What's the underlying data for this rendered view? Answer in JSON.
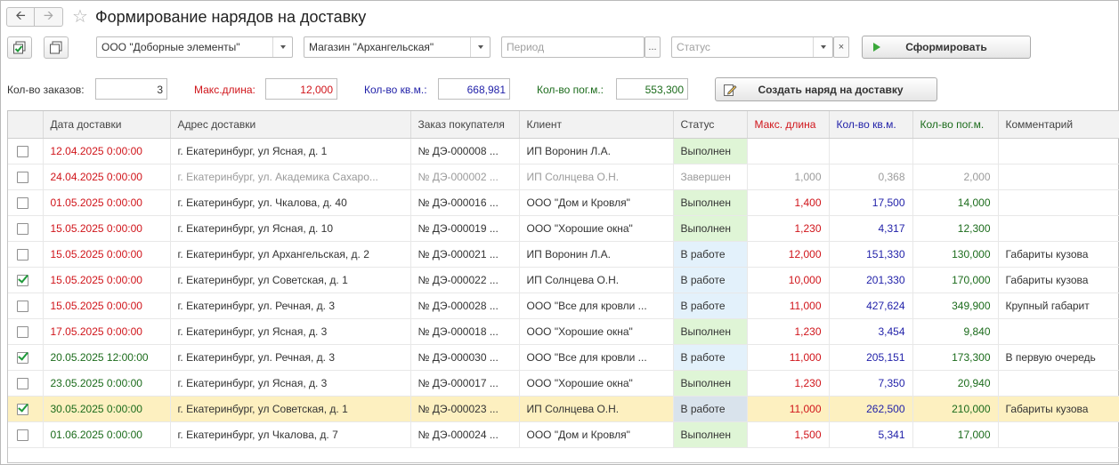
{
  "window": {
    "title": "Формирование нарядов на доставку"
  },
  "toolbar": {
    "organization": "ООО \"Доборные элементы\"",
    "store": "Магазин \"Архангельская\"",
    "period_placeholder": "Период",
    "status_placeholder": "Статус",
    "form_button": "Сформировать"
  },
  "summary": {
    "orders_label": "Кол-во заказов:",
    "orders_value": "3",
    "maxlen_label": "Макс.длина:",
    "maxlen_value": "12,000",
    "sqm_label": "Кол-во кв.м.:",
    "sqm_value": "668,981",
    "lm_label": "Кол-во пог.м.:",
    "lm_value": "553,300",
    "create_button": "Создать наряд на доставку"
  },
  "colors": {
    "red": "#d0141a",
    "blue": "#1f1fa8",
    "green": "#1b6b1b",
    "gray": "#9b9b9b",
    "status_done": "#dff5d6",
    "status_work": "#e3f1fb",
    "status_sel": "#d9e3ec",
    "selected_row": "#fdf0c0"
  },
  "table": {
    "columns": [
      "Дата доставки",
      "Адрес доставки",
      "Заказ покупателя",
      "Клиент",
      "Статус",
      "Макс. длина",
      "Кол-во кв.м.",
      "Кол-во пог.м.",
      "Комментарий"
    ],
    "rows": [
      {
        "checked": false,
        "date": "12.04.2025 0:00:00",
        "date_color": "red",
        "address": "г. Екатеринбург, ул Ясная, д. 1",
        "order": "№ ДЭ-000008 ...",
        "client": "ИП Воронин Л.А.",
        "status": "Выполнен",
        "status_type": "done",
        "maxlen": "",
        "sqm": "",
        "lm": "",
        "comment": "",
        "muted": false,
        "selected": false
      },
      {
        "checked": false,
        "date": "24.04.2025 0:00:00",
        "date_color": "red",
        "address": "г. Екатеринбург, ул. Академика Сахаро...",
        "order": "№ ДЭ-000002 ...",
        "client": "ИП Солнцева О.Н.",
        "status": "Завершен",
        "status_type": "closed",
        "maxlen": "1,000",
        "sqm": "0,368",
        "lm": "2,000",
        "comment": "",
        "muted": true,
        "selected": false
      },
      {
        "checked": false,
        "date": "01.05.2025 0:00:00",
        "date_color": "red",
        "address": "г. Екатеринбург, ул. Чкалова, д. 40",
        "order": "№ ДЭ-000016 ...",
        "client": "ООО \"Дом и Кровля\"",
        "status": "Выполнен",
        "status_type": "done",
        "maxlen": "1,400",
        "sqm": "17,500",
        "lm": "14,000",
        "comment": "",
        "muted": false,
        "selected": false
      },
      {
        "checked": false,
        "date": "15.05.2025 0:00:00",
        "date_color": "red",
        "address": "г. Екатеринбург, ул Ясная, д. 10",
        "order": "№ ДЭ-000019 ...",
        "client": "ООО \"Хорошие окна\"",
        "status": "Выполнен",
        "status_type": "done",
        "maxlen": "1,230",
        "sqm": "4,317",
        "lm": "12,300",
        "comment": "",
        "muted": false,
        "selected": false
      },
      {
        "checked": false,
        "date": "15.05.2025 0:00:00",
        "date_color": "red",
        "address": "г. Екатеринбург, ул Архангельская, д. 2",
        "order": "№ ДЭ-000021 ...",
        "client": "ИП Воронин Л.А.",
        "status": "В работе",
        "status_type": "work",
        "maxlen": "12,000",
        "sqm": "151,330",
        "lm": "130,000",
        "comment": "Габариты кузова",
        "muted": false,
        "selected": false
      },
      {
        "checked": true,
        "date": "15.05.2025 0:00:00",
        "date_color": "red",
        "address": "г. Екатеринбург, ул Советская, д. 1",
        "order": "№ ДЭ-000022 ...",
        "client": "ИП Солнцева О.Н.",
        "status": "В работе",
        "status_type": "work",
        "maxlen": "10,000",
        "sqm": "201,330",
        "lm": "170,000",
        "comment": "Габариты кузова",
        "muted": false,
        "selected": false
      },
      {
        "checked": false,
        "date": "15.05.2025 0:00:00",
        "date_color": "red",
        "address": "г. Екатеринбург, ул. Речная, д. 3",
        "order": "№ ДЭ-000028 ...",
        "client": "ООО \"Все для кровли ...",
        "status": "В работе",
        "status_type": "work",
        "maxlen": "11,000",
        "sqm": "427,624",
        "lm": "349,900",
        "comment": "Крупный габарит",
        "muted": false,
        "selected": false
      },
      {
        "checked": false,
        "date": "17.05.2025 0:00:00",
        "date_color": "red",
        "address": "г. Екатеринбург, ул Ясная, д. 3",
        "order": "№ ДЭ-000018 ...",
        "client": "ООО \"Хорошие окна\"",
        "status": "Выполнен",
        "status_type": "done",
        "maxlen": "1,230",
        "sqm": "3,454",
        "lm": "9,840",
        "comment": "",
        "muted": false,
        "selected": false
      },
      {
        "checked": true,
        "date": "20.05.2025 12:00:00",
        "date_color": "green",
        "address": "г. Екатеринбург, ул. Речная, д. 3",
        "order": "№ ДЭ-000030 ...",
        "client": "ООО \"Все для кровли ...",
        "status": "В работе",
        "status_type": "work",
        "maxlen": "11,000",
        "sqm": "205,151",
        "lm": "173,300",
        "comment": "В первую очередь",
        "muted": false,
        "selected": false
      },
      {
        "checked": false,
        "date": "23.05.2025 0:00:00",
        "date_color": "green",
        "address": "г. Екатеринбург, ул Ясная, д. 3",
        "order": "№ ДЭ-000017 ...",
        "client": "ООО \"Хорошие окна\"",
        "status": "Выполнен",
        "status_type": "done",
        "maxlen": "1,230",
        "sqm": "7,350",
        "lm": "20,940",
        "comment": "",
        "muted": false,
        "selected": false
      },
      {
        "checked": true,
        "date": "30.05.2025 0:00:00",
        "date_color": "green",
        "address": "г. Екатеринбург, ул Советская, д. 1",
        "order": "№ ДЭ-000023 ...",
        "client": "ИП Солнцева О.Н.",
        "status": "В работе",
        "status_type": "work",
        "maxlen": "11,000",
        "sqm": "262,500",
        "lm": "210,000",
        "comment": "Габариты кузова",
        "muted": false,
        "selected": true
      },
      {
        "checked": false,
        "date": "01.06.2025 0:00:00",
        "date_color": "green",
        "address": "г. Екатеринбург, ул Чкалова, д. 7",
        "order": "№ ДЭ-000024 ...",
        "client": "ООО \"Дом и Кровля\"",
        "status": "Выполнен",
        "status_type": "done",
        "maxlen": "1,500",
        "sqm": "5,341",
        "lm": "17,000",
        "comment": "",
        "muted": false,
        "selected": false
      }
    ]
  }
}
